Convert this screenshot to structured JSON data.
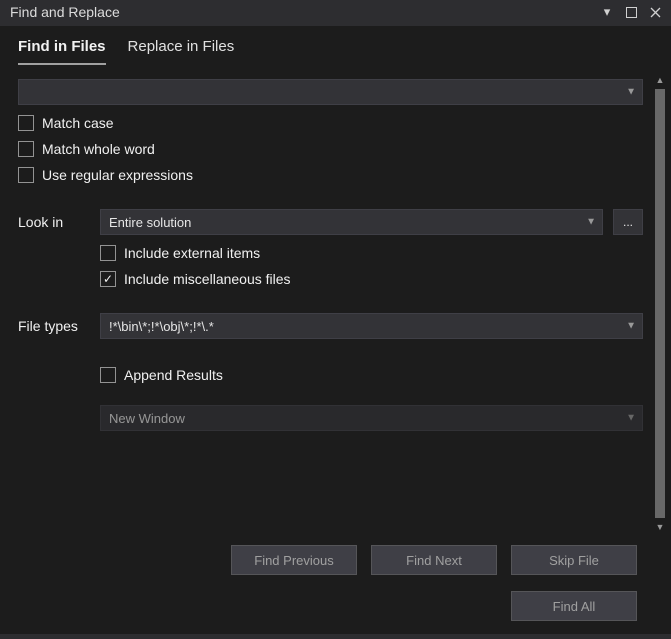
{
  "title": "Find and Replace",
  "tabs": {
    "findInFiles": "Find in Files",
    "replaceInFiles": "Replace in Files",
    "active": "findInFiles"
  },
  "search": {
    "value": ""
  },
  "options": {
    "matchCase": {
      "label": "Match case",
      "checked": false
    },
    "matchWholeWord": {
      "label": "Match whole word",
      "checked": false
    },
    "useRegex": {
      "label": "Use regular expressions",
      "checked": false
    }
  },
  "lookIn": {
    "label": "Look in",
    "value": "Entire solution",
    "browse": "...",
    "includeExternal": {
      "label": "Include external items",
      "checked": false
    },
    "includeMisc": {
      "label": "Include miscellaneous files",
      "checked": true
    }
  },
  "fileTypes": {
    "label": "File types",
    "value": "!*\\bin\\*;!*\\obj\\*;!*\\.*"
  },
  "results": {
    "appendResults": {
      "label": "Append Results",
      "checked": false
    },
    "destination": "New Window"
  },
  "buttons": {
    "findPrevious": "Find Previous",
    "findNext": "Find Next",
    "skipFile": "Skip File",
    "findAll": "Find All"
  }
}
